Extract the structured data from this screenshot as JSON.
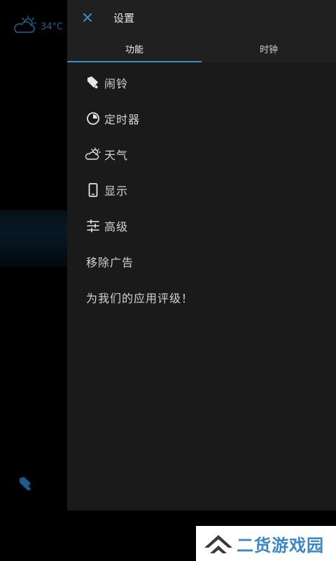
{
  "background": {
    "weather_temp": "34°C"
  },
  "drawer": {
    "title": "设置",
    "tabs": [
      {
        "label": "功能",
        "active": true
      },
      {
        "label": "时钟",
        "active": false
      }
    ],
    "items": [
      {
        "label": "闹铃",
        "icon": "alarm-bell-icon"
      },
      {
        "label": "定时器",
        "icon": "timer-icon"
      },
      {
        "label": "天气",
        "icon": "weather-icon"
      },
      {
        "label": "显示",
        "icon": "phone-display-icon"
      },
      {
        "label": "高级",
        "icon": "sliders-icon"
      },
      {
        "label": "移除广告",
        "icon": ""
      },
      {
        "label": "为我们的应用评级！",
        "icon": ""
      }
    ]
  },
  "watermark": {
    "text": "二货游戏园"
  },
  "colors": {
    "accent": "#3d8ec5",
    "drawer_bg": "#1a1a1a",
    "header_bg": "#202020",
    "text": "#d2d2d2"
  }
}
